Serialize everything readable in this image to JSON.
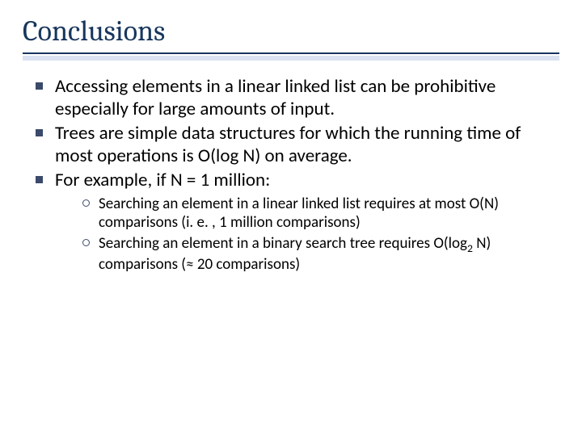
{
  "title": "Conclusions",
  "bullets": {
    "b1": "Accessing elements in a linear linked list can be prohibitive especially for large amounts of input.",
    "b2": "Trees are simple data structures for which the running time of most operations is O(log N) on average.",
    "b3": "For example, if N = 1 million:"
  },
  "subbullets": {
    "s1": "Searching an element in a linear linked list requires at most O(N) comparisons (i. e. , 1 million comparisons)",
    "s2_pre": "Searching an element in a binary search tree requires O(log",
    "s2_sub": "2",
    "s2_post": " N) comparisons (≈ 20 comparisons)"
  }
}
